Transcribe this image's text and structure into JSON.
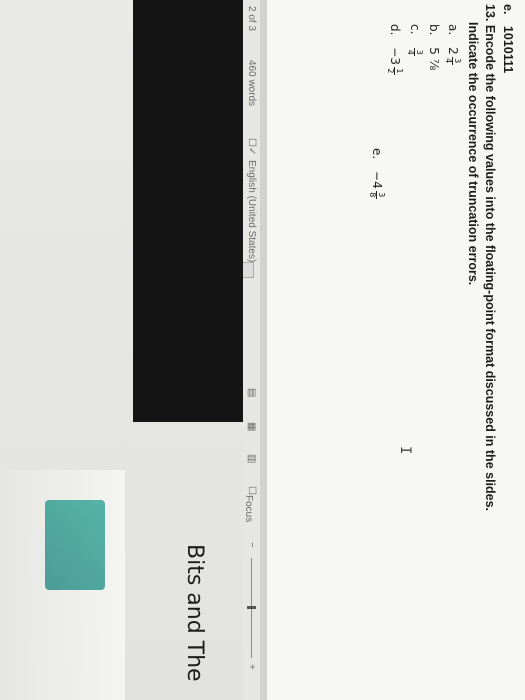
{
  "document": {
    "prev_item_label": "e.",
    "prev_item_value": "1010111",
    "question_number": "13.",
    "question_line1": "Encode the following values into the floating-point format discussed in the slides.",
    "question_line2": "Indicate the occurrence of truncation errors.",
    "items": [
      {
        "label": "a.",
        "whole": "2",
        "num": "3",
        "den": "4"
      },
      {
        "label": "b.",
        "text": "5 ⅞"
      },
      {
        "label": "c.",
        "whole": "",
        "num": "3",
        "den": "4"
      },
      {
        "label": "d.",
        "whole": "−3",
        "num": "1",
        "den": "2"
      },
      {
        "label": "e.",
        "whole": "−4",
        "num": "3",
        "den": "8"
      }
    ]
  },
  "status_bar": {
    "page": "2 of 3",
    "words": "460 words",
    "language": "English (United States)",
    "focus": "Focus",
    "zoom_minus": "−",
    "zoom_plus": "+"
  },
  "background": {
    "window_title": "Bits and The"
  }
}
